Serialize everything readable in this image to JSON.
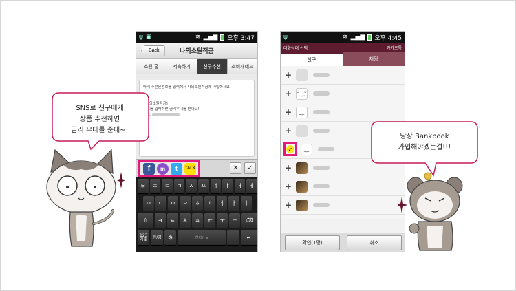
{
  "phone1": {
    "status_time": "오후 3:47",
    "back_label": "Back",
    "title": "나의소원적금",
    "tabs": [
      "소원 홈",
      "저축하기",
      "친구추천",
      "소비재테크"
    ],
    "message": {
      "line1": "아래 추천인번호를 입력해서 나의소원적금에 가입하세요.",
      "line2": "[",
      "line3": "[ 나의소원적금]",
      "line4": "번호를 입력하면 금리우대를 받아요!",
      "line5": "번호:"
    },
    "share_icons": [
      "facebook-icon",
      "messenger-icon",
      "twitter-icon",
      "kakaotalk-icon"
    ],
    "share_labels": {
      "facebook": "f",
      "messenger": "m",
      "twitter": "t",
      "kakao": "TALK"
    },
    "close_label": "✕",
    "confirm_label": "✓",
    "keyboard": {
      "row1": [
        "ㅂ",
        "ㅈ",
        "ㄷ",
        "ㄱ",
        "ㅅ",
        "ㅛ",
        "ㅕ",
        "ㅑ",
        "ㅐ",
        "ㅔ"
      ],
      "row2": [
        "ㅁ",
        "ㄴ",
        "ㅇ",
        "ㄹ",
        "ㅎ",
        "ㅗ",
        "ㅓ",
        "ㅏ",
        "ㅣ"
      ],
      "row3": [
        "⇧",
        "ㅋ",
        "ㅌ",
        "ㅊ",
        "ㅍ",
        "ㅠ",
        "ㅜ",
        "ㅡ",
        "⌫"
      ],
      "row4_numkey": "123",
      "row4_numsub": "기호",
      "row4_lang": "한/영",
      "row4_settings": "⚙",
      "row4_space": "천지인 ∨",
      "row4_period": ".",
      "row4_enter": "↵"
    }
  },
  "phone2": {
    "status_time": "오후 4:45",
    "header_left": "대화상대 선택",
    "header_right": "카카오톡",
    "tabs": [
      "친구",
      "채팅"
    ],
    "confirm_label": "확인(1명)",
    "cancel_label": "취소",
    "list_separator": "L"
  },
  "bubbles": {
    "left": [
      "SNS로 친구에게",
      "상품 추천하면",
      "금리 우대를 준대~!"
    ],
    "right": [
      "당장 Bankbook",
      "가입해야겠는걸!!!"
    ]
  },
  "colors": {
    "highlight": "#e3197b",
    "kakao_header": "#5d1c2f",
    "bubble_border": "#c81c5a"
  }
}
